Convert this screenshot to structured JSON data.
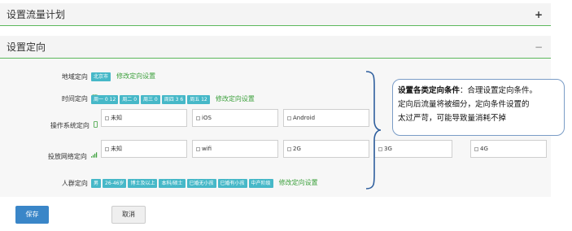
{
  "sections": {
    "traffic_plan": {
      "title": "设置流量计划",
      "toggle": "+"
    },
    "targeting": {
      "title": "设置定向",
      "toggle": "−"
    }
  },
  "region": {
    "label": "地域定向",
    "tags": [
      "北京市"
    ],
    "edit_link": "修改定向设置"
  },
  "time": {
    "label": "时间定向",
    "tags": [
      "周一 0 12",
      "周二 0",
      "周三 0",
      "周四 3 6",
      "周五 12"
    ],
    "edit_link": "修改定向设置"
  },
  "os": {
    "label": "操作系统定向",
    "options": [
      "未知",
      "iOS",
      "Android"
    ]
  },
  "network": {
    "label": "投放网络定向",
    "options": [
      "未知",
      "wifi",
      "2G",
      "3G",
      "4G"
    ]
  },
  "audience": {
    "label": "人群定向",
    "tags": [
      "男",
      "26-46岁",
      "博士及以上",
      "本科/硕士",
      "已婚无小孩",
      "已婚有小孩",
      "中产阶级"
    ],
    "edit_link": "修改定向设置"
  },
  "callout": {
    "title": "设置各类定向条件",
    "text1": "：合理设置定向条件。",
    "text2": "定向后流量将被细分，定向条件设置的",
    "text3": "太过严苛，可能导致量消耗不掉"
  },
  "buttons": {
    "save": "保存",
    "cancel": "取消"
  },
  "colors": {
    "accent_green": "#5cb85c",
    "tag_teal": "#46b8c8",
    "link_green": "#3ca03c",
    "primary_blue": "#3a86c8",
    "callout_border": "#7a9cc6"
  }
}
